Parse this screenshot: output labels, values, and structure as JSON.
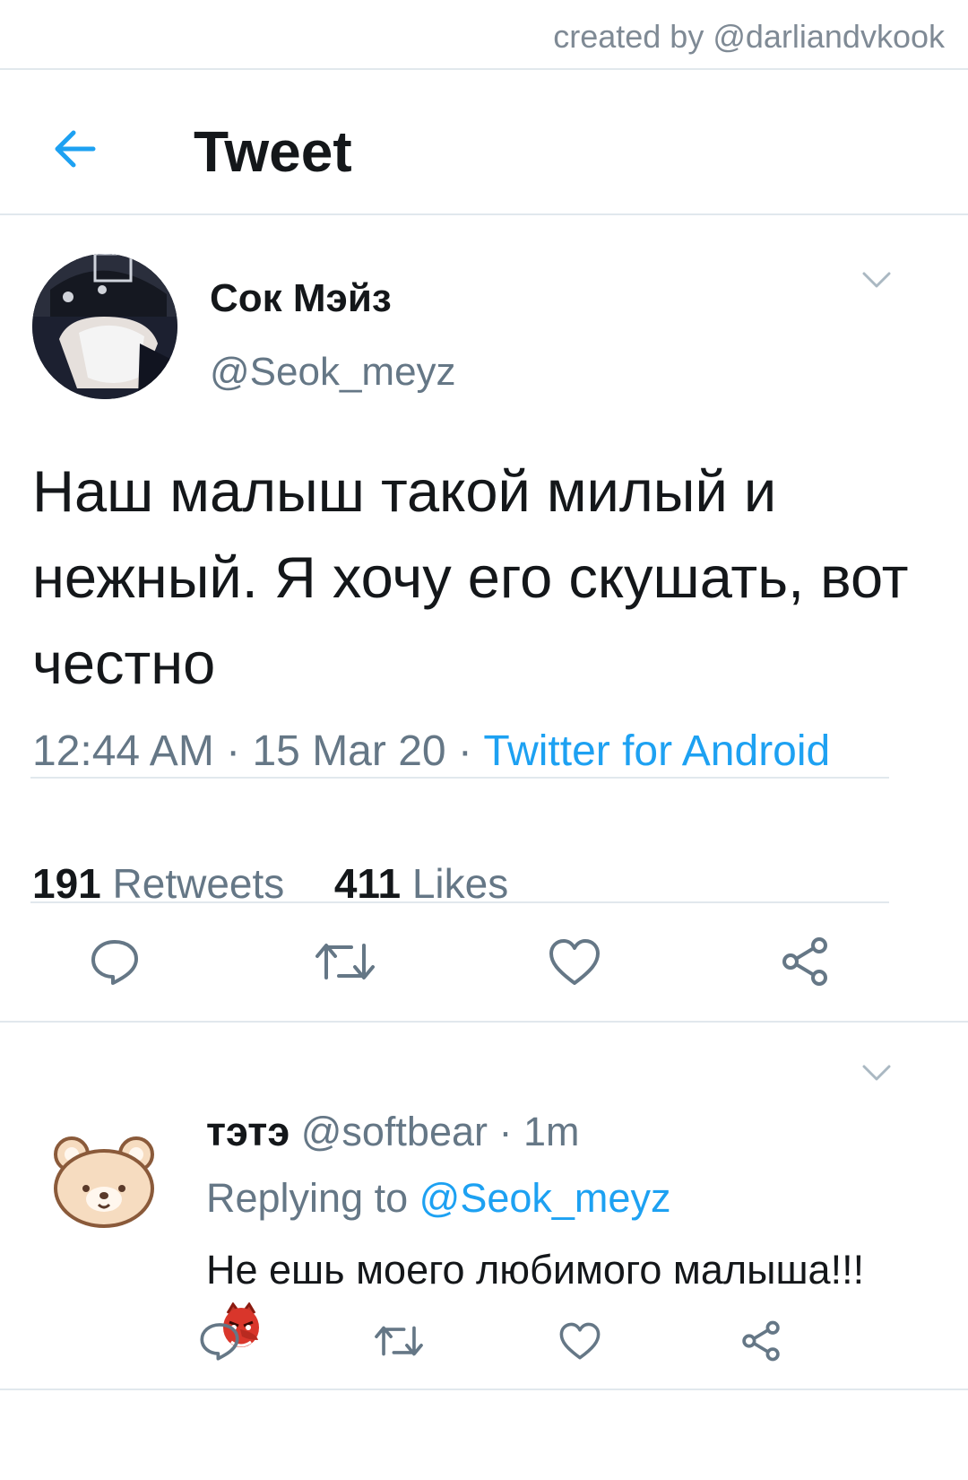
{
  "credit": "created by @darliandvkook",
  "header": {
    "title": "Tweet"
  },
  "tweet": {
    "name": "Сок Мэйз",
    "handle": "@Seok_meyz",
    "text": "Наш малыш такой милый и нежный. Я хочу его скушать, вот честно",
    "time": "12:44 AM",
    "date": "15 Mar 20",
    "source": "Twitter for Android",
    "retweets_count": "191",
    "retweets_label": "Retweets",
    "likes_count": "411",
    "likes_label": "Likes"
  },
  "reply": {
    "name": "тэтэ",
    "handle": "@softbear",
    "age": "1m",
    "replying_prefix": "Replying to",
    "replying_mention": "@Seok_meyz",
    "text": "Не ешь моего любимого малыша!!!"
  },
  "colors": {
    "accent": "#1da1f2",
    "muted": "#657786",
    "rule": "#e1e8ed",
    "text": "#14171a"
  },
  "icons": [
    "back-arrow-icon",
    "chevron-down-icon",
    "reply-icon",
    "retweet-icon",
    "like-icon",
    "share-icon",
    "goblin-emoji-icon"
  ]
}
